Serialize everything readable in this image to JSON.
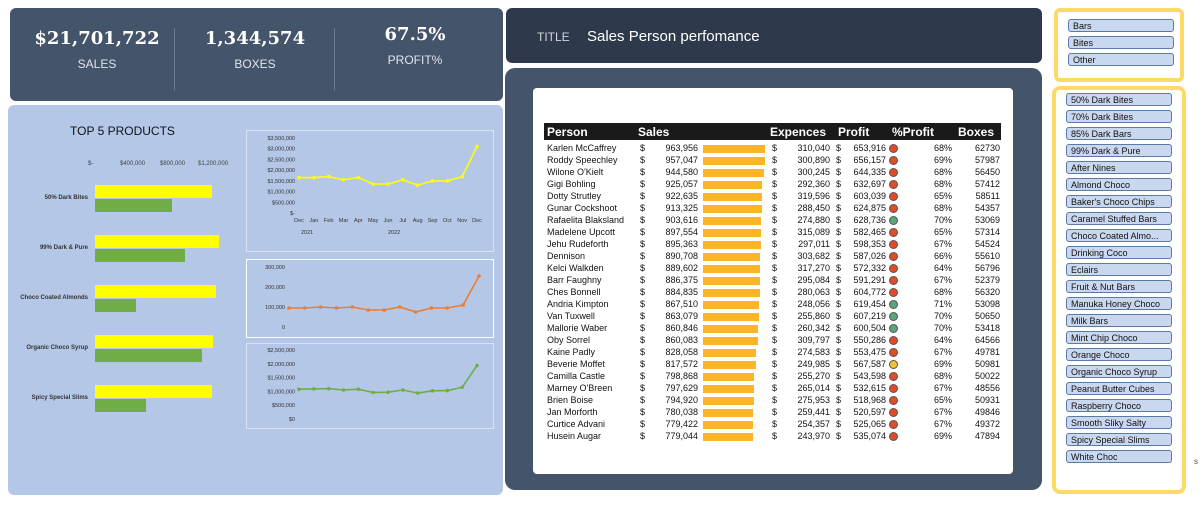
{
  "kpis": {
    "sales_value": "$21,701,722",
    "sales_label": "SALES",
    "boxes_value": "1,344,574",
    "boxes_label": "BOXES",
    "profit_value": "67.5%",
    "profit_label": "PROFIT%"
  },
  "title_panel": {
    "label": "TITLE",
    "text": "Sales Person perfomance"
  },
  "top5": {
    "title": "TOP 5 PRODUCTS",
    "ticks": [
      "$-",
      "$400,000",
      "$800,000",
      "$1,200,000"
    ]
  },
  "chart_data": [
    {
      "type": "bar",
      "title": "TOP 5 PRODUCTS",
      "categories": [
        "50% Dark Bites",
        "99% Dark & Pure",
        "Choco Coated Almonds",
        "Organic Choco Syrup",
        "Spicy Special Slims"
      ],
      "series": [
        {
          "values": [
            1100000,
            1160000,
            1130000,
            1110000,
            1100000
          ]
        },
        {
          "values": [
            720000,
            840000,
            380000,
            1000000,
            480000
          ]
        }
      ],
      "xlim": [
        0,
        1200000
      ],
      "colors": [
        "#ffff00",
        "#70ad47"
      ]
    },
    {
      "type": "line",
      "x": [
        "Dec",
        "Jan",
        "Feb",
        "Mar",
        "Apr",
        "May",
        "Jun",
        "Jul",
        "Aug",
        "Sep",
        "Oct",
        "Nov",
        "Dec"
      ],
      "values": [
        1650000,
        1650000,
        1700000,
        1550000,
        1650000,
        1350000,
        1350000,
        1550000,
        1300000,
        1500000,
        1500000,
        1700000,
        3100000
      ],
      "ylim": [
        0,
        3500000
      ],
      "yticks": [
        "$3,500,000",
        "$3,000,000",
        "$2,500,000",
        "$2,000,000",
        "$1,500,000",
        "$1,000,000",
        "$500,000",
        "$-"
      ],
      "years": [
        "2021",
        "2022"
      ],
      "color": "#ffff00"
    },
    {
      "type": "line",
      "values": [
        95000,
        95000,
        100000,
        95000,
        100000,
        85000,
        85000,
        100000,
        75000,
        95000,
        95000,
        110000,
        255000
      ],
      "ylim": [
        0,
        300000
      ],
      "yticks": [
        "300,000",
        "200,000",
        "100,000",
        "0"
      ],
      "color": "#ed7d31"
    },
    {
      "type": "line",
      "values": [
        1080000,
        1090000,
        1100000,
        1050000,
        1080000,
        960000,
        970000,
        1050000,
        940000,
        1020000,
        1030000,
        1150000,
        1940000
      ],
      "ylim": [
        0,
        2500000
      ],
      "yticks": [
        "$2,500,000",
        "$2,000,000",
        "$1,500,000",
        "$1,000,000",
        "$500,000",
        "$0"
      ],
      "color": "#70ad47"
    }
  ],
  "table": {
    "headers": [
      "Person",
      "Sales",
      "Expences",
      "Profit",
      "%Profit",
      "Boxes"
    ],
    "max_sales": 963956,
    "rows": [
      {
        "person": "Karlen McCaffrey",
        "sales": "963,956",
        "sales_n": 963956,
        "exp": "310,040",
        "profit": "653,916",
        "pct": "68%",
        "dot": "red",
        "boxes": "62730"
      },
      {
        "person": "Roddy Speechley",
        "sales": "957,047",
        "sales_n": 957047,
        "exp": "300,890",
        "profit": "656,157",
        "pct": "69%",
        "dot": "red",
        "boxes": "57987"
      },
      {
        "person": "Wilone O'Kielt",
        "sales": "944,580",
        "sales_n": 944580,
        "exp": "300,245",
        "profit": "644,335",
        "pct": "68%",
        "dot": "red",
        "boxes": "56450"
      },
      {
        "person": "Gigi Bohling",
        "sales": "925,057",
        "sales_n": 925057,
        "exp": "292,360",
        "profit": "632,697",
        "pct": "68%",
        "dot": "red",
        "boxes": "57412"
      },
      {
        "person": "Dotty Strutley",
        "sales": "922,635",
        "sales_n": 922635,
        "exp": "319,596",
        "profit": "603,039",
        "pct": "65%",
        "dot": "red",
        "boxes": "58511"
      },
      {
        "person": "Gunar Cockshoot",
        "sales": "913,325",
        "sales_n": 913325,
        "exp": "288,450",
        "profit": "624,875",
        "pct": "68%",
        "dot": "red",
        "boxes": "54357"
      },
      {
        "person": "Rafaelita Blaksland",
        "sales": "903,616",
        "sales_n": 903616,
        "exp": "274,880",
        "profit": "628,736",
        "pct": "70%",
        "dot": "green",
        "boxes": "53069"
      },
      {
        "person": "Madelene Upcott",
        "sales": "897,554",
        "sales_n": 897554,
        "exp": "315,089",
        "profit": "582,465",
        "pct": "65%",
        "dot": "red",
        "boxes": "57314"
      },
      {
        "person": "Jehu Rudeforth",
        "sales": "895,363",
        "sales_n": 895363,
        "exp": "297,011",
        "profit": "598,353",
        "pct": "67%",
        "dot": "red",
        "boxes": "54524"
      },
      {
        "person": "Dennison",
        "sales": "890,708",
        "sales_n": 890708,
        "exp": "303,682",
        "profit": "587,026",
        "pct": "66%",
        "dot": "red",
        "boxes": "55610"
      },
      {
        "person": "Kelci Walkden",
        "sales": "889,602",
        "sales_n": 889602,
        "exp": "317,270",
        "profit": "572,332",
        "pct": "64%",
        "dot": "red",
        "boxes": "56796"
      },
      {
        "person": "Barr Faughny",
        "sales": "886,375",
        "sales_n": 886375,
        "exp": "295,084",
        "profit": "591,291",
        "pct": "67%",
        "dot": "red",
        "boxes": "52379"
      },
      {
        "person": "Ches Bonnell",
        "sales": "884,835",
        "sales_n": 884835,
        "exp": "280,063",
        "profit": "604,772",
        "pct": "68%",
        "dot": "red",
        "boxes": "56320"
      },
      {
        "person": "Andria Kimpton",
        "sales": "867,510",
        "sales_n": 867510,
        "exp": "248,056",
        "profit": "619,454",
        "pct": "71%",
        "dot": "green",
        "boxes": "53098"
      },
      {
        "person": "Van Tuxwell",
        "sales": "863,079",
        "sales_n": 863079,
        "exp": "255,860",
        "profit": "607,219",
        "pct": "70%",
        "dot": "green",
        "boxes": "50650"
      },
      {
        "person": "Mallorie Waber",
        "sales": "860,846",
        "sales_n": 860846,
        "exp": "260,342",
        "profit": "600,504",
        "pct": "70%",
        "dot": "green",
        "boxes": "53418"
      },
      {
        "person": "Oby Sorrel",
        "sales": "860,083",
        "sales_n": 860083,
        "exp": "309,797",
        "profit": "550,286",
        "pct": "64%",
        "dot": "red",
        "boxes": "64566"
      },
      {
        "person": "Kaine Padly",
        "sales": "828,058",
        "sales_n": 828058,
        "exp": "274,583",
        "profit": "553,475",
        "pct": "67%",
        "dot": "red",
        "boxes": "49781"
      },
      {
        "person": "Beverie Moffet",
        "sales": "817,572",
        "sales_n": 817572,
        "exp": "249,985",
        "profit": "567,587",
        "pct": "69%",
        "dot": "yellow",
        "boxes": "50981"
      },
      {
        "person": "Camilla Castle",
        "sales": "798,868",
        "sales_n": 798868,
        "exp": "255,270",
        "profit": "543,598",
        "pct": "68%",
        "dot": "red",
        "boxes": "50022"
      },
      {
        "person": "Marney O'Breen",
        "sales": "797,629",
        "sales_n": 797629,
        "exp": "265,014",
        "profit": "532,615",
        "pct": "67%",
        "dot": "red",
        "boxes": "48556"
      },
      {
        "person": "Brien Boise",
        "sales": "794,920",
        "sales_n": 794920,
        "exp": "275,953",
        "profit": "518,968",
        "pct": "65%",
        "dot": "red",
        "boxes": "50931"
      },
      {
        "person": "Jan Morforth",
        "sales": "780,038",
        "sales_n": 780038,
        "exp": "259,441",
        "profit": "520,597",
        "pct": "67%",
        "dot": "red",
        "boxes": "49846"
      },
      {
        "person": "Curtice Advani",
        "sales": "779,422",
        "sales_n": 779422,
        "exp": "254,357",
        "profit": "525,065",
        "pct": "67%",
        "dot": "red",
        "boxes": "49372"
      },
      {
        "person": "Husein Augar",
        "sales": "779,044",
        "sales_n": 779044,
        "exp": "243,970",
        "profit": "535,074",
        "pct": "69%",
        "dot": "red",
        "boxes": "47894"
      }
    ]
  },
  "slicer_category": [
    "Bars",
    "Bites",
    "Other"
  ],
  "slicer_product": [
    "50% Dark Bites",
    "70% Dark Bites",
    "85% Dark Bars",
    "99% Dark & Pure",
    "After Nines",
    "Almond Choco",
    "Baker's Choco Chips",
    "Caramel Stuffed Bars",
    "Choco Coated Almo...",
    "Drinking Coco",
    "Eclairs",
    "Fruit & Nut Bars",
    "Manuka Honey Choco",
    "Milk Bars",
    "Mint Chip Choco",
    "Orange Choco",
    "Organic Choco Syrup",
    "Peanut Butter Cubes",
    "Raspberry Choco",
    "Smooth Sliky Salty",
    "Spicy Special Slims",
    "White Choc"
  ],
  "edge_char": "s",
  "colors": {
    "dot_red": "#e24b26",
    "dot_green": "#5aa57a",
    "dot_yellow": "#f2c230",
    "sales_bar": "#fbb52a"
  }
}
